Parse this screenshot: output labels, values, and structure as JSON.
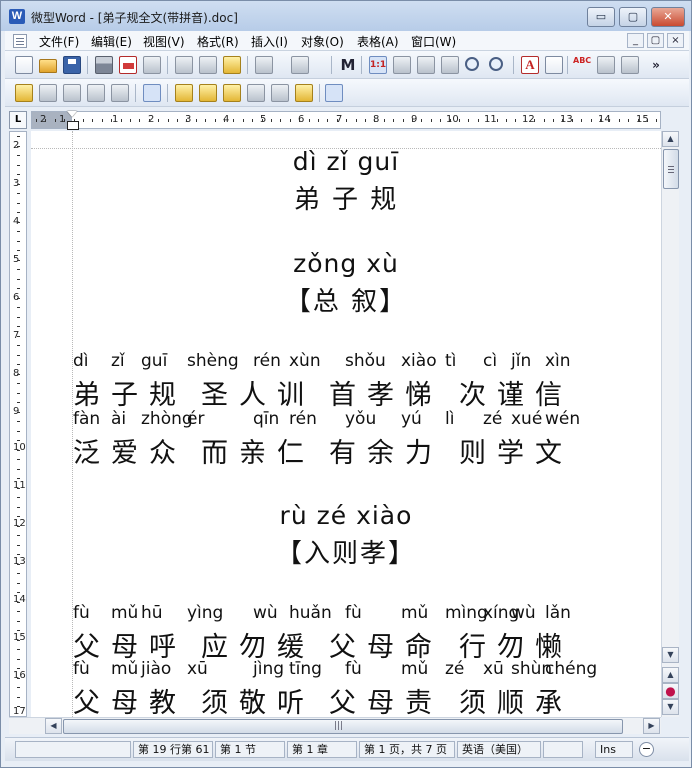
{
  "window": {
    "app_icon": "word-app-icon",
    "title": "微型Word - [弟子规全文(带拼音).doc]",
    "minimize": "▭",
    "maximize": "▢",
    "close": "✕"
  },
  "menu": {
    "items": [
      "文件(F)",
      "编辑(E)",
      "视图(V)",
      "格式(R)",
      "插入(I)",
      "对象(O)",
      "表格(A)",
      "窗口(W)"
    ],
    "mdi": [
      "_",
      "▢",
      "×"
    ]
  },
  "toolbar": {
    "overflow": "»",
    "find_label": "M",
    "spell_label": "ABC",
    "text_a": "A",
    "page_label": "1:1"
  },
  "ruler": {
    "corner": "L",
    "h_numbers": [
      "2",
      "1",
      "1",
      "2",
      "3",
      "4",
      "5",
      "6",
      "7",
      "8",
      "9",
      "10",
      "11",
      "12",
      "13",
      "14",
      "15"
    ],
    "v_numbers": [
      "2",
      "3",
      "4",
      "5",
      "6",
      "7",
      "8",
      "9",
      "10",
      "11",
      "12",
      "13",
      "14",
      "15",
      "16",
      "17"
    ]
  },
  "document": {
    "title_pinyin": "dì   zǐ   guī",
    "title_hanzi": "弟  子  规",
    "section1_pinyin": "zǒng  xù",
    "section1_hanzi": "【总   叙】",
    "verses1": [
      {
        "pinyin": [
          "dì",
          "zǐ",
          "guī",
          "shèng",
          "rén",
          "xùn",
          "shǒu",
          "xiào",
          "tì",
          "cì",
          "jǐn",
          "xìn"
        ],
        "hanzi": [
          "弟",
          "子",
          "规",
          "圣",
          "人",
          "训",
          "首",
          "孝",
          "悌",
          "次",
          "谨",
          "信"
        ]
      },
      {
        "pinyin": [
          "fàn",
          "ài",
          "zhòng",
          "ér",
          "qīn",
          "rén",
          "yǒu",
          "yú",
          "lì",
          "zé",
          "xué",
          "wén"
        ],
        "hanzi": [
          "泛",
          "爱",
          "众",
          "而",
          "亲",
          "仁",
          "有",
          "余",
          "力",
          "则",
          "学",
          "文"
        ]
      }
    ],
    "section2_pinyin": "rù zé xiào",
    "section2_hanzi": "【入则孝】",
    "verses2": [
      {
        "pinyin": [
          "fù",
          "mǔ",
          "hū",
          "yìng",
          "wù",
          "huǎn",
          "fù",
          "mǔ",
          "mìng",
          "xíng",
          "wù",
          "lǎn"
        ],
        "hanzi": [
          "父",
          "母",
          "呼",
          "应",
          "勿",
          "缓",
          "父",
          "母",
          "命",
          "行",
          "勿",
          "懒"
        ]
      },
      {
        "pinyin": [
          "fù",
          "mǔ",
          "jiào",
          "xū",
          "jìng",
          "tīng",
          "fù",
          "mǔ",
          "zé",
          "xū",
          "shùn",
          "chéng"
        ],
        "hanzi": [
          "父",
          "母",
          "教",
          "须",
          "敬",
          "听",
          "父",
          "母",
          "责",
          "须",
          "顺",
          "承"
        ]
      }
    ]
  },
  "scrollbar": {
    "up": "▲",
    "down": "▼",
    "left": "◀",
    "right": "▶",
    "grip": "|||",
    "prev_page": "▲",
    "next_page": "▼"
  },
  "status": {
    "position": "第 19 行第 61",
    "section": "第 1 节",
    "chapter": "第 1 章",
    "pages": "第 1 页，共 7 页",
    "language": "英语（美国）",
    "ins": "Ins",
    "zoom_minus": "−"
  }
}
